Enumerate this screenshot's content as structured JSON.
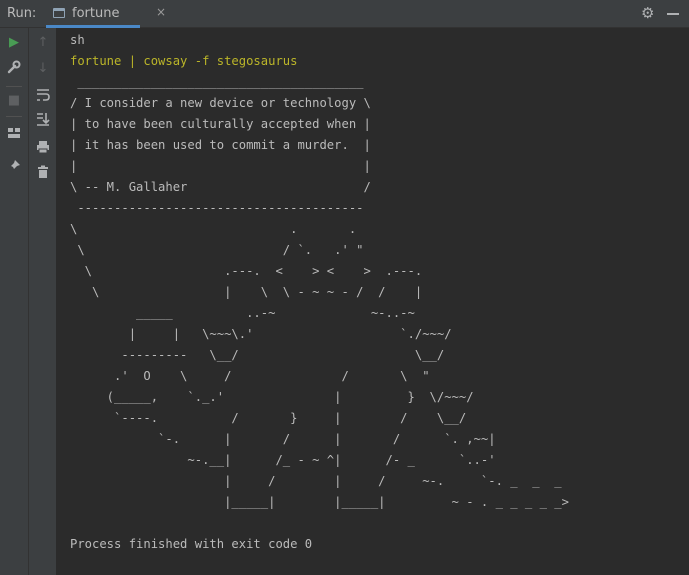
{
  "header": {
    "run_label": "Run:",
    "tab_label": "fortune",
    "close_glyph": "×",
    "settings_icon": "gear-icon",
    "hide_icon": "minus-icon"
  },
  "toolbar_icons": [
    "run-icon",
    "wrench-icon",
    "stop-icon",
    "layout-icon",
    "pin-icon",
    "arrow-up-icon",
    "arrow-down-icon",
    "soft-wrap-icon",
    "scroll-to-end-icon",
    "print-icon",
    "trash-icon"
  ],
  "colors": {
    "header_bg": "#3c3f41",
    "console_bg": "#2b2b2b",
    "console_text": "#bbbbbb",
    "command_text": "#bbb529",
    "run_green": "#499c54",
    "tab_underline": "#4a88c7"
  },
  "console": {
    "lines": [
      "sh",
      "fortune | cowsay -f stegosaurus",
      " _______________________________________",
      "/ I consider a new device or technology \\",
      "| to have been culturally accepted when |",
      "| it has been used to commit a murder.  |",
      "|                                       |",
      "\\ -- M. Gallaher                        /",
      " ---------------------------------------",
      "\\                             .       .",
      " \\                           / `.   .' \"",
      "  \\                  .---.  <    > <    >  .---.",
      "   \\                 |    \\  \\ - ~ ~ - /  /    |",
      "         _____          ..-~             ~-..-~",
      "        |     |   \\~~~\\.'                    `./~~~/",
      "       ---------   \\__/                        \\__/",
      "      .'  O    \\     /               /       \\  \"",
      "     (_____,    `._.'               |         }  \\/~~~/",
      "      `----.          /       }     |        /    \\__/",
      "            `-.      |       /      |       /      `. ,~~|",
      "                ~-.__|      /_ - ~ ^|      /- _      `..-'",
      "                     |     /        |     /     ~-.     `-. _  _  _",
      "                     |_____|        |_____|         ~ - . _ _ _ _ _>",
      "",
      "Process finished with exit code 0"
    ]
  }
}
